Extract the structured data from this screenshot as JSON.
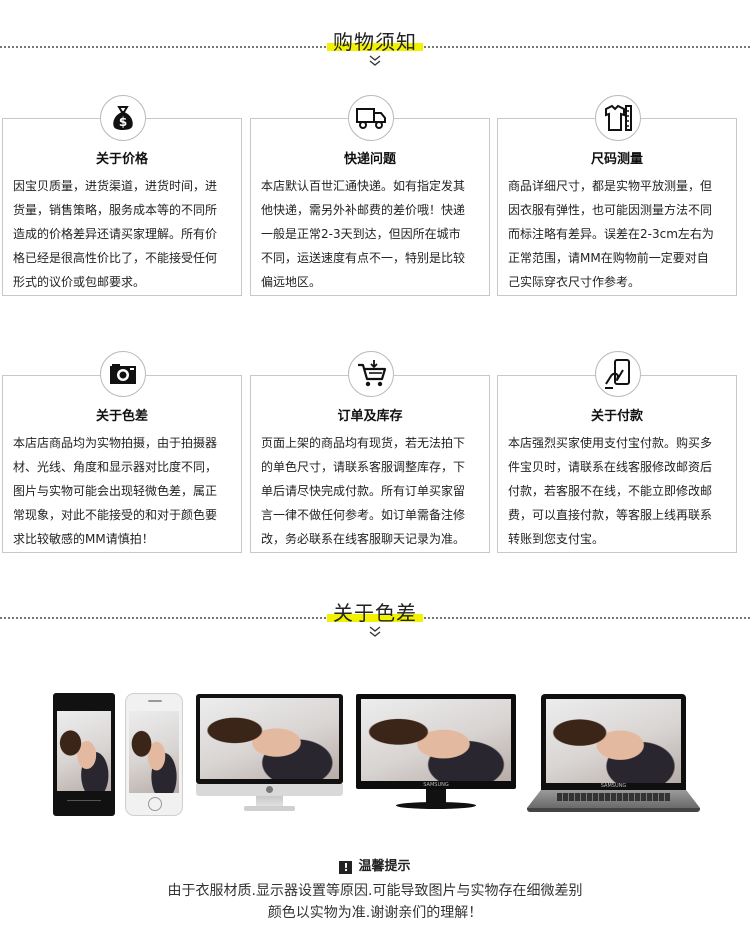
{
  "sections": {
    "shopping": {
      "title": "购物须知"
    },
    "color": {
      "title": "关于色差"
    }
  },
  "cards": [
    {
      "icon": "money-bag-icon",
      "title": "关于价格",
      "lines": [
        "因宝贝质量，进货渠道，进货时间，进",
        "货量，销售策略，服务成本等的不同所",
        "造成的价格差异还请买家理解。所有价",
        "格已经是很高性价比了，不能接受任何",
        "形式的议价或包邮要求。"
      ]
    },
    {
      "icon": "delivery-truck-icon",
      "title": "快递问题",
      "lines": [
        "本店默认百世汇通快递。如有指定发其",
        "他快递，需另外补邮费的差价哦！快递",
        "一般是正常2-3天到达，但因所在城市",
        "不同，运送速度有点不一，特别是比较",
        "偏远地区。"
      ]
    },
    {
      "icon": "shirt-ruler-icon",
      "title": "尺码测量",
      "lines": [
        "商品详细尺寸，都是实物平放测量，但",
        "因衣服有弹性，也可能因测量方法不同",
        "而标注略有差异。误差在2-3cm左右为",
        "正常范围，请MM在购物前一定要对自",
        "己实际穿衣尺寸作参考。"
      ]
    },
    {
      "icon": "camera-icon",
      "title": "关于色差",
      "lines": [
        "本店店商品均为实物拍摄，由于拍摄器",
        "材、光线、角度和显示器对比度不同，",
        "图片与实物可能会出现轻微色差，属正",
        "常现象，对此不能接受的和对于颜色要",
        "求比较敏感的MM请慎拍！"
      ]
    },
    {
      "icon": "shopping-cart-icon",
      "title": "订单及库存",
      "lines": [
        "页面上架的商品均有现货，若无法拍下",
        "的单色尺寸，请联系客服调整库存，下",
        "单后请尽快完成付款。所有订单买家留",
        "言一律不做任何参考。如订单需备注修",
        "改，务必联系在线客服聊天记录为准。"
      ]
    },
    {
      "icon": "payment-hand-icon",
      "title": "关于付款",
      "lines": [
        "本店强烈买家使用支付宝付款。购买多",
        "件宝贝时，请联系在线客服修改邮资后",
        "付款，若客服不在线，不能立即修改邮",
        "费，可以直接付款，等客服上线再联系",
        "转账到您支付宝。"
      ]
    }
  ],
  "devices": {
    "monitor_brand": "SAMSUNG",
    "laptop_brand": "SAMSUNG"
  },
  "notice": {
    "badge": "!",
    "title": "温馨提示",
    "line1": "由于衣服材质.显示器设置等原因.可能导致图片与实物存在细微差别",
    "line2": "颜色以实物为准.谢谢亲们的理解！"
  }
}
